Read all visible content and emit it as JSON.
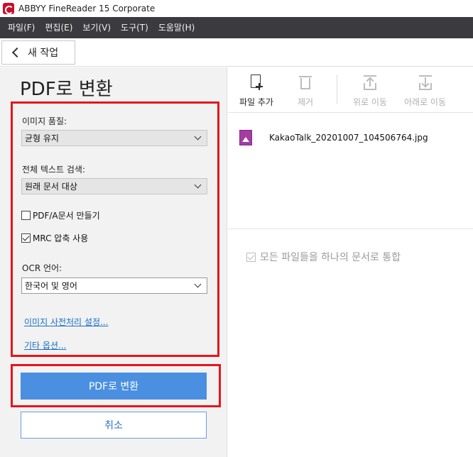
{
  "window": {
    "title": "ABBYY FineReader 15 Corporate"
  },
  "menu": [
    "파일(F)",
    "편집(E)",
    "보기(V)",
    "도구(T)",
    "도움말(H)"
  ],
  "toolbar": {
    "new_task_label": "새 작업"
  },
  "left_panel": {
    "title": "PDF로 변환",
    "image_quality": {
      "label": "이미지 품질:",
      "value": "균형 유지"
    },
    "fulltext_search": {
      "label": "전체 텍스트 검색:",
      "value": "원래 문서 대상"
    },
    "pdfa": {
      "label": "PDF/A문서 만들기",
      "checked": false
    },
    "mrc": {
      "label": "MRC 압축 사용",
      "checked": true
    },
    "ocr_language": {
      "label": "OCR 언어:",
      "value": "한국어 및 영어"
    },
    "links": {
      "preprocessing": "이미지 사전처리 설정...",
      "other_options": "기타 옵션..."
    },
    "convert_button": "PDF로 변환",
    "cancel_button": "취소"
  },
  "right_panel": {
    "tools": {
      "add_file": "파일 추가",
      "remove": "제거",
      "move_up": "위로 이동",
      "move_down": "아래로 이동"
    },
    "files": [
      {
        "name": "KakaoTalk_20201007_104506764.jpg"
      }
    ],
    "merge": {
      "label": "모든 파일들을 하나의 문서로 통합",
      "checked": true
    }
  },
  "colors": {
    "menubar_bg": "#3b3b3f",
    "accent_blue": "#4a8fe0",
    "highlight_red": "#e4161c",
    "link_blue": "#1a6fc9"
  }
}
